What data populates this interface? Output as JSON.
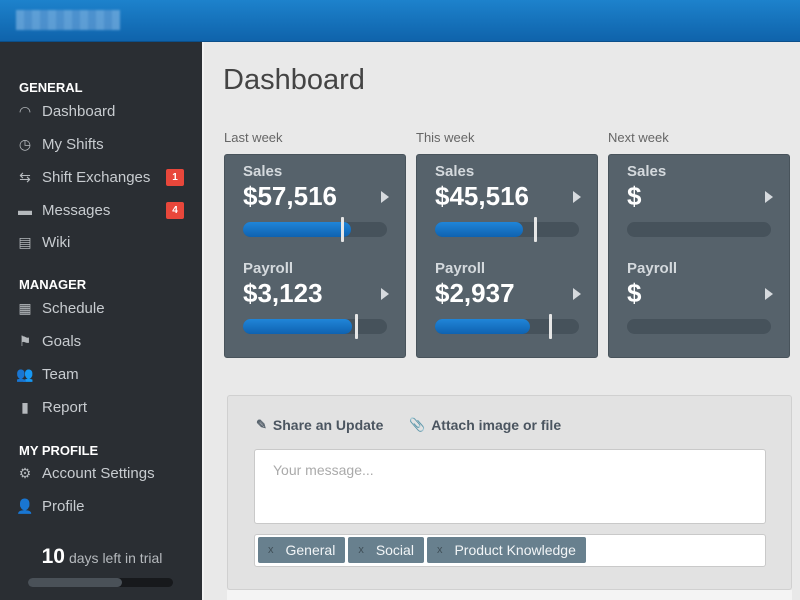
{
  "sidebar": {
    "sections": [
      {
        "title": "GENERAL",
        "items": [
          {
            "label": "Dashboard",
            "icon": "gauge-icon"
          },
          {
            "label": "My Shifts",
            "icon": "clock-icon"
          },
          {
            "label": "Shift Exchanges",
            "icon": "exchange-icon",
            "badge": "1"
          },
          {
            "label": "Messages",
            "icon": "comment-icon",
            "badge": "4"
          },
          {
            "label": "Wiki",
            "icon": "archive-icon"
          }
        ]
      },
      {
        "title": "MANAGER",
        "items": [
          {
            "label": "Schedule",
            "icon": "calendar-icon"
          },
          {
            "label": "Goals",
            "icon": "flag-icon"
          },
          {
            "label": "Team",
            "icon": "users-icon"
          },
          {
            "label": "Report",
            "icon": "clipboard-icon"
          }
        ]
      },
      {
        "title": "MY PROFILE",
        "items": [
          {
            "label": "Account Settings",
            "icon": "gear-icon"
          },
          {
            "label": "Profile",
            "icon": "user-icon"
          }
        ]
      }
    ],
    "trial": {
      "days": "10",
      "text": "days left in trial",
      "progress": 0.65
    }
  },
  "main": {
    "title": "Dashboard",
    "weeks": [
      {
        "label": "Last week",
        "sales_label": "Sales",
        "sales": "$57,516",
        "sales_fill": 0.75,
        "sales_target": 0.68,
        "payroll_label": "Payroll",
        "payroll": "$3,123",
        "payroll_fill": 0.76,
        "payroll_target": 0.78
      },
      {
        "label": "This week",
        "sales_label": "Sales",
        "sales": "$45,516",
        "sales_fill": 0.61,
        "sales_target": 0.69,
        "payroll_label": "Payroll",
        "payroll": "$2,937",
        "payroll_fill": 0.66,
        "payroll_target": 0.79
      },
      {
        "label": "Next week",
        "sales_label": "Sales",
        "sales": "$",
        "payroll_label": "Payroll",
        "payroll": "$"
      }
    ],
    "composer": {
      "share_label": "Share an Update",
      "attach_label": "Attach image or file",
      "placeholder": "Your message...",
      "tags": [
        "General",
        "Social",
        "Product Knowledge"
      ],
      "tag_remove": "x"
    }
  },
  "colors": {
    "accent": "#1a78c6",
    "sidebar": "#2a2e33",
    "badge": "#e8473b",
    "card": "#56626b"
  }
}
